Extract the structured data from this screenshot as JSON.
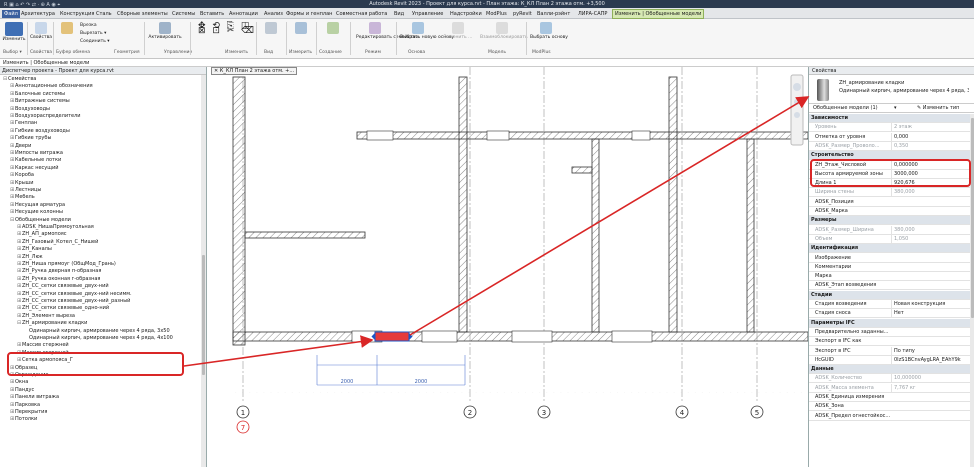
{
  "title_bar": {
    "quick_access": "R ▣ ⌂ ↶ ↷ ⇄ · ⊕ A ◉ ⌖",
    "title": "Autodesk Revit 2023 - Проект для курса.rvt - План этажа: К_КЛ План 2 этажа отм. +3,500"
  },
  "ribbon_tabs": [
    "Файл",
    "Архитектура",
    "Конструкция",
    "Сталь",
    "Сборные элементы",
    "Системы",
    "Вставить",
    "Аннотации",
    "Анализ",
    "Формы и генплан",
    "Совместная работа",
    "Вид",
    "Управление",
    "Надстройки",
    "ModPlus",
    "pyRevit",
    "Валли-рэйнт",
    "ЛИРА-САПР",
    "Изменить | Обобщенные модели"
  ],
  "ribbon": {
    "buttons": [
      "Изменить",
      "Свойства",
      "Буфер обмена",
      "Вырезать",
      "Соединить",
      "Активировать",
      "Вставить",
      "Измерить",
      "Создание",
      "Редактировать семейство",
      "Выбрать новую основу",
      "Заменить ...",
      "Взаимоблокировать",
      "Выбрать основу"
    ],
    "small": {
      "cut": "Вырезать ▾",
      "join": "Соединить ▾",
      "trim": "Врезка"
    },
    "groups": [
      "Выбор ▾",
      "Свойства",
      "Буфер обмена",
      "Геометрия",
      "Управление",
      "Изменить",
      "Вид",
      "Измерить",
      "Создание",
      "Режим",
      "Основа",
      "Модель",
      "ModPlus"
    ]
  },
  "context_bar": "Изменить | Обобщенные модели",
  "project_browser": {
    "title": "Диспетчер проекта - Проект для курса.rvt",
    "items": [
      {
        "label": "Семейства",
        "lvl": 0,
        "sign": "⊟"
      },
      {
        "label": "Аннотационные обозначения",
        "lvl": 1,
        "sign": "⊞"
      },
      {
        "label": "Балочные системы",
        "lvl": 1,
        "sign": "⊞"
      },
      {
        "label": "Витражные системы",
        "lvl": 1,
        "sign": "⊞"
      },
      {
        "label": "Воздуховоды",
        "lvl": 1,
        "sign": "⊞"
      },
      {
        "label": "Воздухораспределители",
        "lvl": 1,
        "sign": "⊞"
      },
      {
        "label": "Генплан",
        "lvl": 1,
        "sign": "⊞"
      },
      {
        "label": "Гибкие воздуховоды",
        "lvl": 1,
        "sign": "⊞"
      },
      {
        "label": "Гибкие трубы",
        "lvl": 1,
        "sign": "⊞"
      },
      {
        "label": "Двери",
        "lvl": 1,
        "sign": "⊞"
      },
      {
        "label": "Импосты витража",
        "lvl": 1,
        "sign": "⊞"
      },
      {
        "label": "Кабельные лотки",
        "lvl": 1,
        "sign": "⊞"
      },
      {
        "label": "Каркас несущий",
        "lvl": 1,
        "sign": "⊞"
      },
      {
        "label": "Короба",
        "lvl": 1,
        "sign": "⊞"
      },
      {
        "label": "Крыши",
        "lvl": 1,
        "sign": "⊞"
      },
      {
        "label": "Лестницы",
        "lvl": 1,
        "sign": "⊞"
      },
      {
        "label": "Мебель",
        "lvl": 1,
        "sign": "⊞"
      },
      {
        "label": "Несущая арматура",
        "lvl": 1,
        "sign": "⊞"
      },
      {
        "label": "Несущие колонны",
        "lvl": 1,
        "sign": "⊞"
      },
      {
        "label": "Обобщенные модели",
        "lvl": 1,
        "sign": "⊟"
      },
      {
        "label": "ADSK_НишаПрямоугольная",
        "lvl": 2,
        "sign": "⊞"
      },
      {
        "label": "ZH_АП_армопояс",
        "lvl": 2,
        "sign": "⊞"
      },
      {
        "label": "ZH_Газовый_Котел_С_Нишей",
        "lvl": 2,
        "sign": "⊞"
      },
      {
        "label": "ZH_Каналы",
        "lvl": 2,
        "sign": "⊞"
      },
      {
        "label": "ZH_Люк",
        "lvl": 2,
        "sign": "⊞"
      },
      {
        "label": "ZH_Ниша прямоуг (ОбщМод_Грань)",
        "lvl": 2,
        "sign": "⊞"
      },
      {
        "label": "ZH_Ручка дверная п-образная",
        "lvl": 2,
        "sign": "⊞"
      },
      {
        "label": "ZH_Ручка оконная г-образная",
        "lvl": 2,
        "sign": "⊞"
      },
      {
        "label": "ZH_СС_сетки связевые_двух-ний",
        "lvl": 2,
        "sign": "⊞"
      },
      {
        "label": "ZH_СС_сетки связевые_двух-ний несимм.",
        "lvl": 2,
        "sign": "⊞"
      },
      {
        "label": "ZH_СС_сетки связевые_двух-ний_разный",
        "lvl": 2,
        "sign": "⊞"
      },
      {
        "label": "ZH_СС_сетки связевые_одно-ний",
        "lvl": 2,
        "sign": "⊞"
      },
      {
        "label": "ZH_Элемент выреза",
        "lvl": 2,
        "sign": "⊞"
      },
      {
        "label": "ZH_армирование кладки",
        "lvl": 2,
        "sign": "⊟"
      },
      {
        "label": "Одинарный кирпич, армирование через 4 ряда, 3х50",
        "lvl": 3,
        "sign": ""
      },
      {
        "label": "Одинарный кирпич, армирование через 4 ряда, 4х100",
        "lvl": 3,
        "sign": ""
      },
      {
        "label": "Массив стержней",
        "lvl": 2,
        "sign": "⊞"
      },
      {
        "label": "Массив стержней",
        "lvl": 2,
        "sign": "⊞"
      },
      {
        "label": "Сетка армопояса_Г",
        "lvl": 2,
        "sign": "⊞"
      },
      {
        "label": "Образец",
        "lvl": 1,
        "sign": "⊞"
      },
      {
        "label": "Ограждение",
        "lvl": 1,
        "sign": "⊞"
      },
      {
        "label": "Окна",
        "lvl": 1,
        "sign": "⊞"
      },
      {
        "label": "Пандус",
        "lvl": 1,
        "sign": "⊞"
      },
      {
        "label": "Панели витража",
        "lvl": 1,
        "sign": "⊞"
      },
      {
        "label": "Парковка",
        "lvl": 1,
        "sign": "⊞"
      },
      {
        "label": "Перекрытия",
        "lvl": 1,
        "sign": "⊞"
      },
      {
        "label": "Потолки",
        "lvl": 1,
        "sign": "⊞"
      }
    ]
  },
  "view": {
    "tab_label": "К_КЛ План 2 этажа отм. +...",
    "grid_labels": [
      "1",
      "2",
      "3",
      "4",
      "5"
    ],
    "grid_label_red": "7",
    "dims": [
      "2000",
      "2000"
    ]
  },
  "properties": {
    "title": "Свойства",
    "family_name": "ZH_армирование кладки",
    "family_type": "Одинарный кирпич, армирование через 4 ряда, 3х...",
    "selector": "Обобщенные модели (1)",
    "edit_type": "Изменить тип",
    "rows": [
      {
        "k": "Зависимости",
        "v": "",
        "t": "cat"
      },
      {
        "k": "Уровень",
        "v": "2 этаж",
        "t": "dim"
      },
      {
        "k": "Отметка от уровня",
        "v": "0,000",
        "t": ""
      },
      {
        "k": "ADSK_Размер_Проволо...",
        "v": "0,350",
        "t": "dim"
      },
      {
        "k": "Строительство",
        "v": "",
        "t": "cat"
      },
      {
        "k": "ZH_Этаж_Числовой",
        "v": "0,000000",
        "t": ""
      },
      {
        "k": "Высота армируемой зоны",
        "v": "3000,000",
        "t": ""
      },
      {
        "k": "Длина 1",
        "v": "920,676",
        "t": ""
      },
      {
        "k": "Ширина стены",
        "v": "380,000",
        "t": "dim"
      },
      {
        "k": "ADSK_Позиция",
        "v": "",
        "t": ""
      },
      {
        "k": "ADSK_Марка",
        "v": "",
        "t": ""
      },
      {
        "k": "Размеры",
        "v": "",
        "t": "cat"
      },
      {
        "k": "ADSK_Размер_Ширина",
        "v": "380,000",
        "t": "dim"
      },
      {
        "k": "Объем",
        "v": "1,050",
        "t": "dim"
      },
      {
        "k": "Идентификация",
        "v": "",
        "t": "cat"
      },
      {
        "k": "Изображение",
        "v": "",
        "t": ""
      },
      {
        "k": "Комментарии",
        "v": "",
        "t": ""
      },
      {
        "k": "Марка",
        "v": "",
        "t": ""
      },
      {
        "k": "ADSK_Этап возведения",
        "v": "",
        "t": ""
      },
      {
        "k": "Стадии",
        "v": "",
        "t": "cat"
      },
      {
        "k": "Стадия возведения",
        "v": "Новая конструкция",
        "t": ""
      },
      {
        "k": "Стадия сноса",
        "v": "Нет",
        "t": ""
      },
      {
        "k": "Параметры IFC",
        "v": "",
        "t": "cat"
      },
      {
        "k": "Предварительно заданны...",
        "v": "",
        "t": ""
      },
      {
        "k": "Экспорт в IFC как",
        "v": "",
        "t": ""
      },
      {
        "k": "Экспорт в IFC",
        "v": "По типу",
        "t": ""
      },
      {
        "k": "IfcGUID",
        "v": "0IzS1BCnvAygLRA_EAhY9k",
        "t": ""
      },
      {
        "k": "Данные",
        "v": "",
        "t": "cat"
      },
      {
        "k": "ADSK_Количество",
        "v": "10,000000",
        "t": "dim"
      },
      {
        "k": "ADSK_Масса элемента",
        "v": "7,767 кг",
        "t": "dim"
      },
      {
        "k": "ADSK_Единица измерения",
        "v": "",
        "t": ""
      },
      {
        "k": "ADSK_Зона",
        "v": "",
        "t": ""
      },
      {
        "k": "ADSK_Предел огнестойкос...",
        "v": "",
        "t": ""
      }
    ]
  },
  "colors": {
    "accent_red": "#d92626",
    "title_bg": "#2b3a4f",
    "active_tab": "#d7e9b3",
    "category_bg": "#dde3ea"
  }
}
